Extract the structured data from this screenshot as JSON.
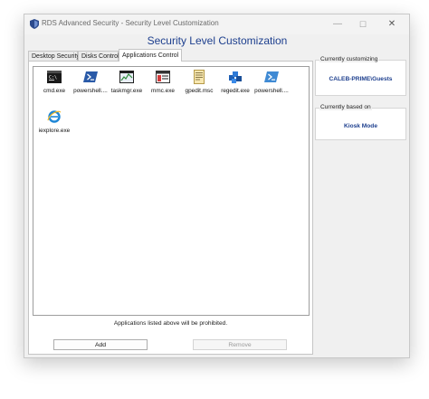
{
  "window": {
    "title": "RDS Advanced Security - Security Level Customization"
  },
  "heading": "Security Level Customization",
  "tabs": [
    {
      "label": "Desktop Security",
      "active": false
    },
    {
      "label": "Disks Control",
      "active": false
    },
    {
      "label": "Applications Control",
      "active": true
    }
  ],
  "applications": [
    {
      "label": "cmd.exe",
      "icon": "cmd-icon"
    },
    {
      "label": "powershell....",
      "icon": "powershell-icon"
    },
    {
      "label": "taskmgr.exe",
      "icon": "task-manager-icon"
    },
    {
      "label": "mmc.exe",
      "icon": "mmc-icon"
    },
    {
      "label": "gpedit.msc",
      "icon": "gpedit-icon"
    },
    {
      "label": "regedit.exe",
      "icon": "regedit-icon"
    },
    {
      "label": "powershell....",
      "icon": "powershell-ise-icon"
    },
    {
      "label": "iexplore.exe",
      "icon": "internet-explorer-icon"
    }
  ],
  "list_note": "Applications listed above will be prohibited.",
  "buttons": {
    "add": "Add",
    "remove": "Remove"
  },
  "currently_customizing": {
    "title": "Currently customizing",
    "value": "CALEB-PRIME\\Guests"
  },
  "currently_based_on": {
    "title": "Currently based on",
    "value": "Kiosk Mode"
  },
  "colors": {
    "accent": "#1d3f8e"
  }
}
